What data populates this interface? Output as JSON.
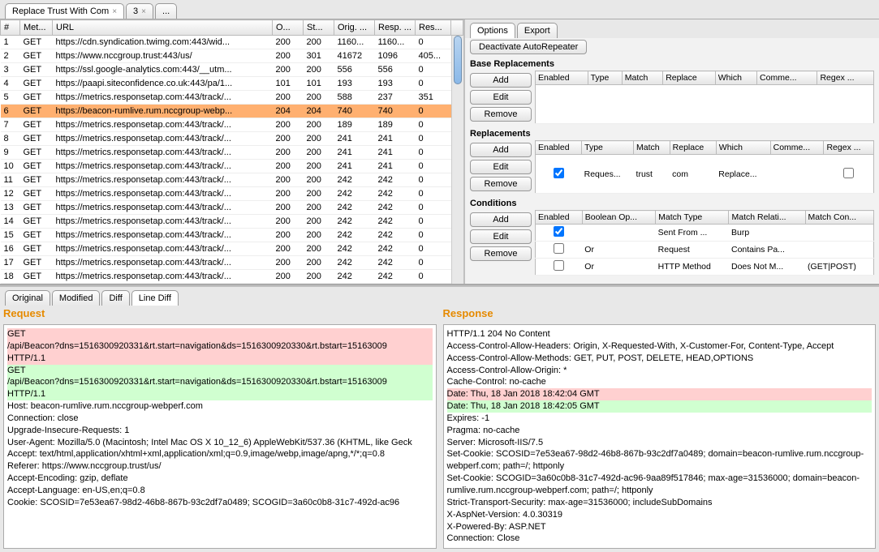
{
  "tabs": [
    {
      "label": "Replace Trust With Com",
      "closable": true,
      "active": true
    },
    {
      "label": "3",
      "closable": true
    },
    {
      "label": "..."
    }
  ],
  "log": {
    "headers": [
      "#",
      "Met...",
      "URL",
      "O...",
      "St...",
      "Orig. ...",
      "Resp. ...",
      "Res..."
    ],
    "rows": [
      [
        "1",
        "GET",
        "https://cdn.syndication.twimg.com:443/wid...",
        "200",
        "200",
        "1160...",
        "1160...",
        "0"
      ],
      [
        "2",
        "GET",
        "https://www.nccgroup.trust:443/us/",
        "200",
        "301",
        "41672",
        "1096",
        "405..."
      ],
      [
        "3",
        "GET",
        "https://ssl.google-analytics.com:443/__utm...",
        "200",
        "200",
        "556",
        "556",
        "0"
      ],
      [
        "4",
        "GET",
        "https://paapi.siteconfidence.co.uk:443/pa/1...",
        "101",
        "101",
        "193",
        "193",
        "0"
      ],
      [
        "5",
        "GET",
        "https://metrics.responsetap.com:443/track/...",
        "200",
        "200",
        "588",
        "237",
        "351"
      ],
      [
        "6",
        "GET",
        "https://beacon-rumlive.rum.nccgroup-webp...",
        "204",
        "204",
        "740",
        "740",
        "0"
      ],
      [
        "7",
        "GET",
        "https://metrics.responsetap.com:443/track/...",
        "200",
        "200",
        "189",
        "189",
        "0"
      ],
      [
        "8",
        "GET",
        "https://metrics.responsetap.com:443/track/...",
        "200",
        "200",
        "241",
        "241",
        "0"
      ],
      [
        "9",
        "GET",
        "https://metrics.responsetap.com:443/track/...",
        "200",
        "200",
        "241",
        "241",
        "0"
      ],
      [
        "10",
        "GET",
        "https://metrics.responsetap.com:443/track/...",
        "200",
        "200",
        "241",
        "241",
        "0"
      ],
      [
        "11",
        "GET",
        "https://metrics.responsetap.com:443/track/...",
        "200",
        "200",
        "242",
        "242",
        "0"
      ],
      [
        "12",
        "GET",
        "https://metrics.responsetap.com:443/track/...",
        "200",
        "200",
        "242",
        "242",
        "0"
      ],
      [
        "13",
        "GET",
        "https://metrics.responsetap.com:443/track/...",
        "200",
        "200",
        "242",
        "242",
        "0"
      ],
      [
        "14",
        "GET",
        "https://metrics.responsetap.com:443/track/...",
        "200",
        "200",
        "242",
        "242",
        "0"
      ],
      [
        "15",
        "GET",
        "https://metrics.responsetap.com:443/track/...",
        "200",
        "200",
        "242",
        "242",
        "0"
      ],
      [
        "16",
        "GET",
        "https://metrics.responsetap.com:443/track/...",
        "200",
        "200",
        "242",
        "242",
        "0"
      ],
      [
        "17",
        "GET",
        "https://metrics.responsetap.com:443/track/...",
        "200",
        "200",
        "242",
        "242",
        "0"
      ],
      [
        "18",
        "GET",
        "https://metrics.responsetap.com:443/track/...",
        "200",
        "200",
        "242",
        "242",
        "0"
      ]
    ],
    "selected_index": 5
  },
  "right": {
    "tabs": [
      "Options",
      "Export"
    ],
    "deactivate": "Deactivate AutoRepeater",
    "base": {
      "title": "Base Replacements",
      "buttons": [
        "Add",
        "Edit",
        "Remove"
      ],
      "headers": [
        "Enabled",
        "Type",
        "Match",
        "Replace",
        "Which",
        "Comme...",
        "Regex ..."
      ]
    },
    "repl": {
      "title": "Replacements",
      "buttons": [
        "Add",
        "Edit",
        "Remove"
      ],
      "headers": [
        "Enabled",
        "Type",
        "Match",
        "Replace",
        "Which",
        "Comme...",
        "Regex ..."
      ],
      "row": {
        "enabled": true,
        "type": "Reques...",
        "match": "trust",
        "replace": "com",
        "which": "Replace...",
        "comment": "",
        "regex": false
      }
    },
    "cond": {
      "title": "Conditions",
      "buttons": [
        "Add",
        "Edit",
        "Remove"
      ],
      "headers": [
        "Enabled",
        "Boolean Op...",
        "Match Type",
        "Match Relati...",
        "Match Con..."
      ],
      "rows": [
        {
          "enabled": true,
          "op": "",
          "type": "Sent From ...",
          "rel": "Burp",
          "con": ""
        },
        {
          "enabled": false,
          "op": "Or",
          "type": "Request",
          "rel": "Contains Pa...",
          "con": ""
        },
        {
          "enabled": false,
          "op": "Or",
          "type": "HTTP Method",
          "rel": "Does Not M...",
          "con": "(GET|POST)"
        }
      ]
    }
  },
  "diff": {
    "tabs": [
      "Original",
      "Modified",
      "Diff",
      "Line Diff"
    ],
    "active": 3,
    "request": {
      "title": "Request",
      "lines": [
        {
          "t": "GET",
          "c": "red"
        },
        {
          "t": "/api/Beacon?dns=1516300920331&rt.start=navigation&ds=1516300920330&rt.bstart=15163009",
          "c": "red"
        },
        {
          "t": "HTTP/1.1",
          "c": "red"
        },
        {
          "t": "GET",
          "c": "green"
        },
        {
          "t": "/api/Beacon?dns=1516300920331&rt.start=navigation&ds=1516300920330&rt.bstart=15163009",
          "c": "green"
        },
        {
          "t": "HTTP/1.1",
          "c": "green"
        },
        {
          "t": "Host: beacon-rumlive.rum.nccgroup-webperf.com"
        },
        {
          "t": "Connection: close"
        },
        {
          "t": "Upgrade-Insecure-Requests: 1"
        },
        {
          "t": "User-Agent: Mozilla/5.0 (Macintosh; Intel Mac OS X 10_12_6) AppleWebKit/537.36 (KHTML, like Geck"
        },
        {
          "t": "Accept: text/html,application/xhtml+xml,application/xml;q=0.9,image/webp,image/apng,*/*;q=0.8"
        },
        {
          "t": "Referer: https://www.nccgroup.trust/us/"
        },
        {
          "t": "Accept-Encoding: gzip, deflate"
        },
        {
          "t": "Accept-Language: en-US,en;q=0.8"
        },
        {
          "t": "Cookie: SCOSID=7e53ea67-98d2-46b8-867b-93c2df7a0489; SCOGID=3a60c0b8-31c7-492d-ac96"
        }
      ]
    },
    "response": {
      "title": "Response",
      "lines": [
        {
          "t": "HTTP/1.1 204 No Content"
        },
        {
          "t": "Access-Control-Allow-Headers: Origin, X-Requested-With, X-Customer-For, Content-Type, Accept"
        },
        {
          "t": "Access-Control-Allow-Methods: GET, PUT, POST, DELETE, HEAD,OPTIONS"
        },
        {
          "t": "Access-Control-Allow-Origin: *"
        },
        {
          "t": "Cache-Control: no-cache"
        },
        {
          "t": "Date: Thu, 18 Jan 2018 18:42:04 GMT",
          "c": "red"
        },
        {
          "t": "Date: Thu, 18 Jan 2018 18:42:05 GMT",
          "c": "green"
        },
        {
          "t": "Expires: -1"
        },
        {
          "t": "Pragma: no-cache"
        },
        {
          "t": "Server: Microsoft-IIS/7.5"
        },
        {
          "t": "Set-Cookie: SCOSID=7e53ea67-98d2-46b8-867b-93c2df7a0489; domain=beacon-rumlive.rum.nccgroup-webperf.com; path=/; httponly"
        },
        {
          "t": "Set-Cookie: SCOGID=3a60c0b8-31c7-492d-ac96-9aa89f517846; max-age=31536000; domain=beacon-rumlive.rum.nccgroup-webperf.com; path=/; httponly"
        },
        {
          "t": "Strict-Transport-Security: max-age=31536000; includeSubDomains"
        },
        {
          "t": "X-AspNet-Version: 4.0.30319"
        },
        {
          "t": "X-Powered-By: ASP.NET"
        },
        {
          "t": "Connection: Close"
        }
      ]
    }
  }
}
